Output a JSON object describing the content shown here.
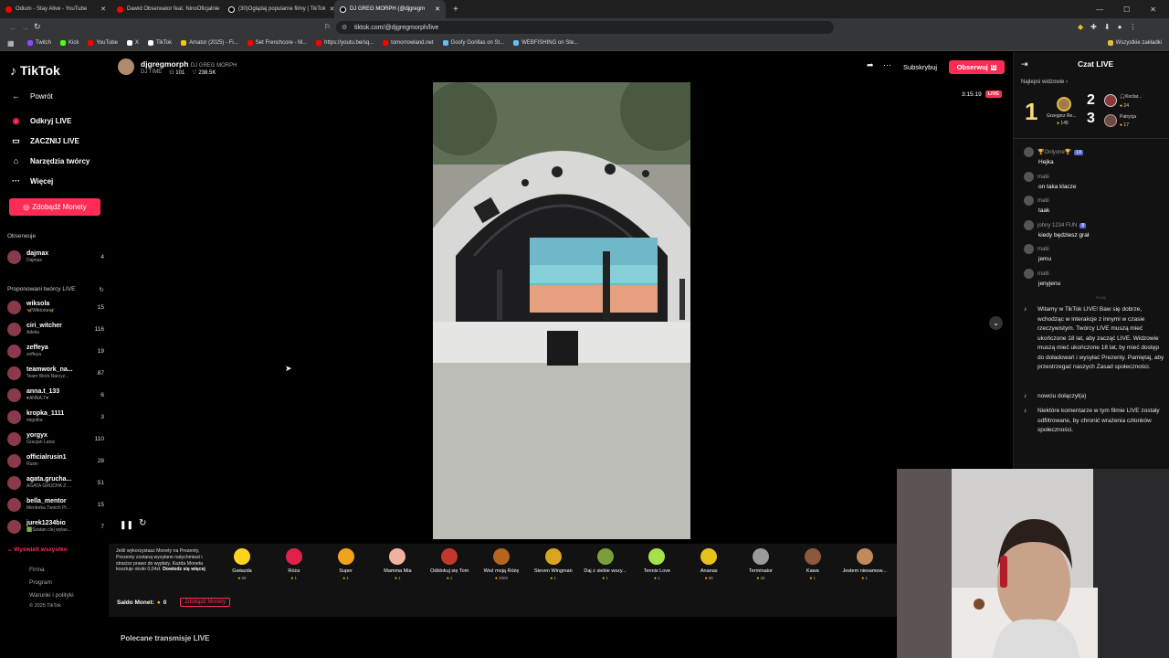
{
  "browser": {
    "tabs": [
      {
        "title": "Odium - Stay Alive - YouTube",
        "color": "#ff0000"
      },
      {
        "title": "Dawid Obserwator feat. NinoOficjalnie",
        "color": "#ff0000"
      },
      {
        "title": "(30)Oglądaj popularne filmy | TikTok",
        "color": "#ffffff"
      },
      {
        "title": "DJ GREG MORPH (@djgregm",
        "color": "#ffffff"
      }
    ],
    "new_tab": "+",
    "url": "tiktok.com/@djgregmorph/live",
    "bookmarks": [
      {
        "label": "Twitch",
        "color": "#9146ff"
      },
      {
        "label": "Kick",
        "color": "#53fc18"
      },
      {
        "label": "YouTube",
        "color": "#ff0000"
      },
      {
        "label": "X",
        "color": "#ffffff"
      },
      {
        "label": "TikTok",
        "color": "#ffffff"
      },
      {
        "label": "Amator (2025) - Fi...",
        "color": "#f5c518"
      },
      {
        "label": "Set Frenchcore - M...",
        "color": "#ff0000"
      },
      {
        "label": "https://youtu.be/sq...",
        "color": "#ff0000"
      },
      {
        "label": "tomorrowland.net",
        "color": "#ff0000"
      },
      {
        "label": "Goofy Gorillas on St...",
        "color": "#66c0f4"
      },
      {
        "label": "WEBFISHING on Ste...",
        "color": "#66c0f4"
      }
    ],
    "all_bookmarks": "Wszystkie zakładki"
  },
  "nav": {
    "logo": "TikTok",
    "back": "Powrót",
    "items": [
      {
        "label": "Odkryj LIVE",
        "icon": "live-icon"
      },
      {
        "label": "ZACZNIJ LIVE",
        "icon": "camera-icon"
      },
      {
        "label": "Narzędzia twórcy",
        "icon": "home-icon"
      },
      {
        "label": "Więcej",
        "icon": "more-icon"
      }
    ],
    "coins_button": "Zdobądź Monety",
    "following_title": "Obserwuje",
    "following": [
      {
        "name": "dajmax",
        "sub": "Dajmax",
        "count": "4"
      }
    ],
    "suggested_title": "Proponowani twórcy LIVE",
    "suggested": [
      {
        "name": "wiksola",
        "sub": "🦋Wiktoria🦋",
        "count": "15"
      },
      {
        "name": "ciri_witcher",
        "sub": "Adelia",
        "count": "116"
      },
      {
        "name": "zeffeya",
        "sub": "zeffeya",
        "count": "19"
      },
      {
        "name": "teamwork_na...",
        "sub": "Team Work Narcyz...",
        "count": "87"
      },
      {
        "name": "anna.t_133",
        "sub": "♥ANNA.T♥",
        "count": "6"
      },
      {
        "name": "kropka_1111",
        "sub": "migotka",
        "count": "3"
      },
      {
        "name": "yorgyx",
        "sub": "Gracjan Latos",
        "count": "110"
      },
      {
        "name": "officialrusin1",
        "sub": "Rusin",
        "count": "28"
      },
      {
        "name": "agata.grucha...",
        "sub": "AGATA GRUCHA Z ...",
        "count": "51"
      },
      {
        "name": "bella_mentor",
        "sub": "Mentorka Twoich Pr...",
        "count": "15"
      },
      {
        "name": "jurek1234bio",
        "sub": "🟩Szatan ciej wylas...",
        "count": "7"
      }
    ],
    "show_all": "Wyświetl wszystko",
    "footer": [
      "Firma",
      "Program",
      "Warunki i polityki",
      "© 2025 TikTok"
    ]
  },
  "stream": {
    "host": "djgregmorph",
    "host_display": "DJ GREG MORPH",
    "host_tag": "DJ TIME",
    "viewers": "101",
    "likes": "238.5K",
    "subscribe": "Subskrybuj",
    "follow": "Obserwuj",
    "timer": "3:15:19",
    "live_badge": "LIVE"
  },
  "gifts": {
    "info": "Jeśli wykorzystasz Monety na Prezenty, Prezenty zostaną wysyłane natychmiast i stracisz prawo do wypłaty. Każda Moneta kosztuje około 0,04zł.",
    "info_link": "Dowiedz się więcej",
    "items": [
      {
        "name": "Gwiazda",
        "price": "99",
        "color": "#ffd21e"
      },
      {
        "name": "Róża",
        "price": "1",
        "color": "#e0224a"
      },
      {
        "name": "Super",
        "price": "1",
        "color": "#f2a31c"
      },
      {
        "name": "Mamma Mia",
        "price": "1",
        "color": "#f1b1a0"
      },
      {
        "name": "Odblokuj się Tom",
        "price": "1",
        "color": "#c0392b"
      },
      {
        "name": "Weź moją Różę",
        "price": "2000",
        "color": "#b5651d"
      },
      {
        "name": "Steven Wingman",
        "price": "1",
        "color": "#d9a520"
      },
      {
        "name": "Daj z siebie wszy...",
        "price": "1",
        "color": "#7a9e3a"
      },
      {
        "name": "Tennis Love",
        "price": "1",
        "color": "#a8e04a"
      },
      {
        "name": "Ananas",
        "price": "99",
        "color": "#e8c21c"
      },
      {
        "name": "Terminator",
        "price": "25",
        "color": "#9a9a9a"
      },
      {
        "name": "Kawa",
        "price": "1",
        "color": "#8b5a3c"
      },
      {
        "name": "Jestem niesamow...",
        "price": "1",
        "color": "#c08a5a"
      }
    ],
    "balance_label": "Saldo Monet:",
    "balance": "0",
    "get_coins": "Zdobądź Monety"
  },
  "recommended": "Polecane transmisje LIVE",
  "chat": {
    "title": "Czat LIVE",
    "top_viewers": "Najlepsi widzowie",
    "ranks": [
      {
        "rank": "1",
        "name": "Grzegorz Re...",
        "score": "145"
      },
      {
        "rank": "2",
        "name": "🎧Koclar...",
        "score": "24"
      },
      {
        "rank": "3",
        "name": "Patrycja",
        "score": "17"
      }
    ],
    "messages": [
      {
        "user": "🏆Onlyone🏆",
        "text": "Hejka",
        "badge": "14",
        "color": "#999999"
      },
      {
        "user": "matii",
        "text": "on taka klacze",
        "badge": "",
        "color": "#999999"
      },
      {
        "user": "matii",
        "text": "taak",
        "badge": "",
        "color": "#999999"
      },
      {
        "user": "johny 1234 FUN",
        "text": "kiedy będziesz grał",
        "badge": "8",
        "color": "#999999"
      },
      {
        "user": "matii",
        "text": "jemu",
        "badge": "",
        "color": "#999999"
      },
      {
        "user": "matii",
        "text": "jenyjenu",
        "badge": "",
        "color": "#999999"
      }
    ],
    "divider": "Nowy",
    "system": [
      "Witamy w TikTok LIVE! Baw się dobrze, wchodząc w interakcje z innymi w czasie rzeczywistym. Twórcy LIVE muszą mieć ukończone 18 lat, aby zacząć LIVE. Widzowie muszą mieć ukończone 18 lat, by mieć dostęp do doładowań i wysyłać Prezenty. Pamiętaj, aby przestrzegać naszych Zasad społeczności.",
      "nowciu dołączył(a)",
      "Niektóre komentarze w tym filmie LIVE zostały odfiltrowane, by chronić wrażenia członków społeczności."
    ]
  }
}
